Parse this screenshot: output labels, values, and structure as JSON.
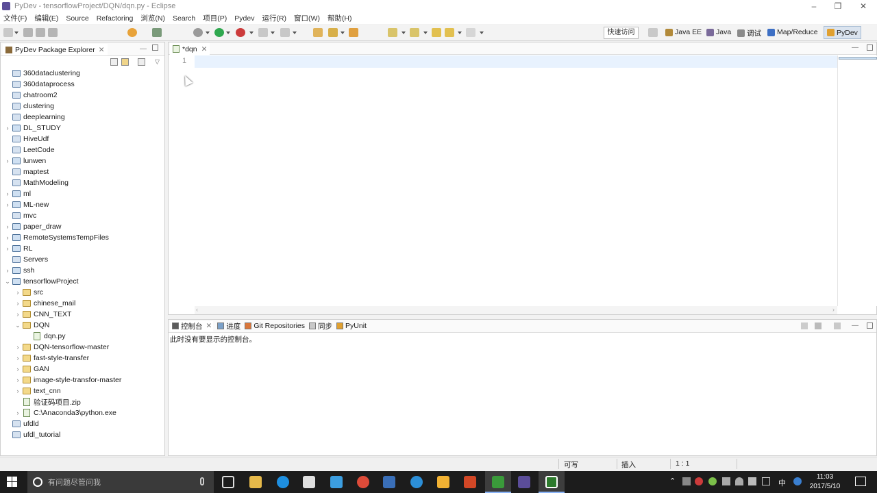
{
  "window": {
    "title": "PyDev - tensorflowProject/DQN/dqn.py - Eclipse"
  },
  "menu": [
    "文件(F)",
    "编辑(E)",
    "Source",
    "Refactoring",
    "浏览(N)",
    "Search",
    "项目(P)",
    "Pydev",
    "运行(R)",
    "窗口(W)",
    "帮助(H)"
  ],
  "toolbar": {
    "quick_access": "快速访问",
    "perspectives": [
      "Java EE",
      "Java",
      "调试",
      "Map/Reduce",
      "PyDev"
    ],
    "active_perspective": "PyDev"
  },
  "explorer": {
    "tab_label": "PyDev Package Explorer",
    "items": [
      {
        "label": "360dataclustering",
        "level": 0,
        "expand": "",
        "kind": "project"
      },
      {
        "label": "360dataprocess",
        "level": 0,
        "expand": "",
        "kind": "project"
      },
      {
        "label": "chatroom2",
        "level": 0,
        "expand": "",
        "kind": "project"
      },
      {
        "label": "clustering",
        "level": 0,
        "expand": "",
        "kind": "project"
      },
      {
        "label": "deeplearning",
        "level": 0,
        "expand": "",
        "kind": "project"
      },
      {
        "label": "DL_STUDY",
        "level": 0,
        "expand": "collapsed",
        "kind": "openproject"
      },
      {
        "label": "HiveUdf",
        "level": 0,
        "expand": "",
        "kind": "project"
      },
      {
        "label": "LeetCode",
        "level": 0,
        "expand": "",
        "kind": "project"
      },
      {
        "label": "lunwen",
        "level": 0,
        "expand": "collapsed",
        "kind": "openproject"
      },
      {
        "label": "maptest",
        "level": 0,
        "expand": "",
        "kind": "project"
      },
      {
        "label": "MathModeling",
        "level": 0,
        "expand": "",
        "kind": "project"
      },
      {
        "label": "ml",
        "level": 0,
        "expand": "collapsed",
        "kind": "openproject"
      },
      {
        "label": "ML-new",
        "level": 0,
        "expand": "collapsed",
        "kind": "openproject"
      },
      {
        "label": "mvc",
        "level": 0,
        "expand": "",
        "kind": "project"
      },
      {
        "label": "paper_draw",
        "level": 0,
        "expand": "collapsed",
        "kind": "openproject"
      },
      {
        "label": "RemoteSystemsTempFiles",
        "level": 0,
        "expand": "collapsed",
        "kind": "openproject"
      },
      {
        "label": "RL",
        "level": 0,
        "expand": "collapsed",
        "kind": "openproject"
      },
      {
        "label": "Servers",
        "level": 0,
        "expand": "",
        "kind": "project"
      },
      {
        "label": "ssh",
        "level": 0,
        "expand": "collapsed",
        "kind": "openproject"
      },
      {
        "label": "tensorflowProject",
        "level": 0,
        "expand": "expanded",
        "kind": "openproject"
      },
      {
        "label": "src",
        "level": 1,
        "expand": "collapsed",
        "kind": "folder"
      },
      {
        "label": "chinese_mail",
        "level": 1,
        "expand": "collapsed",
        "kind": "folder"
      },
      {
        "label": "CNN_TEXT",
        "level": 1,
        "expand": "collapsed",
        "kind": "folder"
      },
      {
        "label": "DQN",
        "level": 1,
        "expand": "expanded",
        "kind": "folder"
      },
      {
        "label": "dqn.py",
        "level": 2,
        "expand": "",
        "kind": "file"
      },
      {
        "label": "DQN-tensorflow-master",
        "level": 1,
        "expand": "collapsed",
        "kind": "folder"
      },
      {
        "label": "fast-style-transfer",
        "level": 1,
        "expand": "collapsed",
        "kind": "folder"
      },
      {
        "label": "GAN",
        "level": 1,
        "expand": "collapsed",
        "kind": "folder"
      },
      {
        "label": "image-style-transfor-master",
        "level": 1,
        "expand": "collapsed",
        "kind": "folder"
      },
      {
        "label": "text_cnn",
        "level": 1,
        "expand": "collapsed",
        "kind": "folder"
      },
      {
        "label": "验证码项目.zip",
        "level": 1,
        "expand": "",
        "kind": "file"
      },
      {
        "label": "C:\\Anaconda3\\python.exe",
        "level": 1,
        "expand": "collapsed",
        "kind": "file"
      },
      {
        "label": "ufdld",
        "level": 0,
        "expand": "",
        "kind": "project"
      },
      {
        "label": "ufdl_tutorial",
        "level": 0,
        "expand": "",
        "kind": "project"
      }
    ]
  },
  "editor": {
    "tab_label": "*dqn",
    "line_number": "1"
  },
  "console": {
    "tabs": [
      "控制台",
      "进度",
      "Git Repositories",
      "同步",
      "PyUnit"
    ],
    "message": "此时没有要显示的控制台。"
  },
  "status": {
    "writable": "可写",
    "insert_mode": "插入",
    "position": "1 : 1"
  },
  "taskbar": {
    "search_placeholder": "有问题尽管问我",
    "time": "11:03",
    "date": "2017/5/10",
    "ime": "中"
  }
}
